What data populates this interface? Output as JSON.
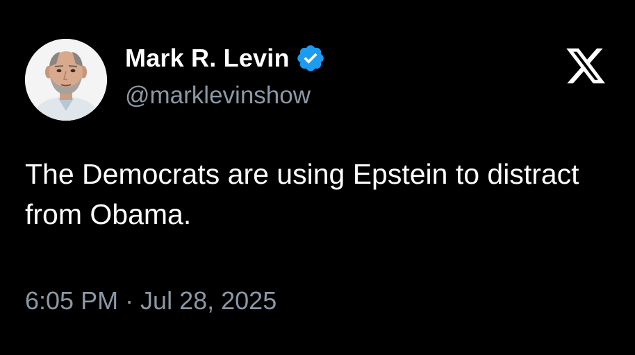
{
  "author": {
    "display_name": "Mark R. Levin",
    "username": "@marklevinshow",
    "verified": true,
    "verified_color": "#1d9bf0",
    "avatar_icon": "profile-photo"
  },
  "tweet": {
    "text": "The Democrats are using Epstein to distract from Obama.",
    "timestamp": "6:05 PM · Jul 28, 2025"
  },
  "brand": {
    "logo": "x-logo-icon"
  },
  "colors": {
    "background": "#000000",
    "primary_text": "#ffffff",
    "secondary_text": "#8b98a5"
  }
}
